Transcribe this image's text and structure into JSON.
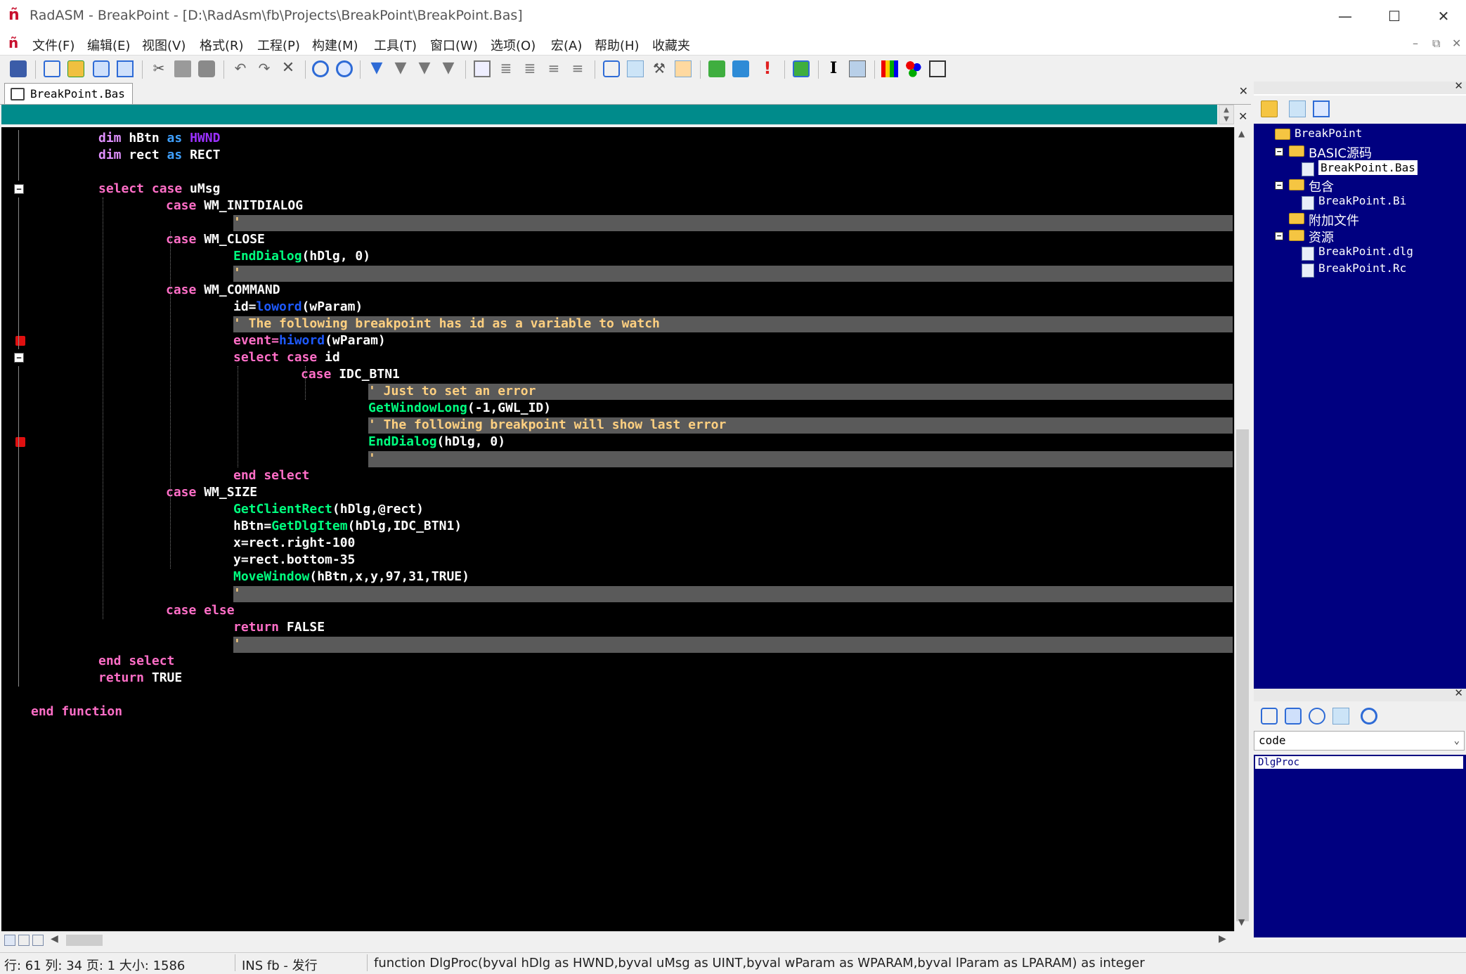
{
  "window": {
    "title": "RadASM - BreakPoint - [D:\\RadAsm\\fb\\Projects\\BreakPoint\\BreakPoint.Bas]",
    "minimize": "—",
    "maximize": "☐",
    "close": "✕"
  },
  "menu": {
    "items": [
      "文件(F)",
      "编辑(E)",
      "视图(V)",
      "格式(R)",
      "工程(P)",
      "构建(M)",
      "工具(T)",
      "窗口(W)",
      "选项(O)",
      "宏(A)",
      "帮助(H)",
      "收藏夹"
    ]
  },
  "toolbar": {
    "icons": [
      "print-icon",
      "new-file-icon",
      "open-file-icon",
      "save-icon",
      "save-all-icon",
      "cut-icon",
      "copy-icon",
      "paste-icon",
      "undo-icon",
      "redo-icon",
      "delete-icon",
      "find-icon",
      "replace-icon",
      "bookmark-toggle-icon",
      "bookmark-next-icon",
      "bookmark-prev-icon",
      "bookmark-clear-icon",
      "block-comment-icon",
      "indent-icon",
      "outdent-icon",
      "comment-icon",
      "uncomment-icon",
      "view-output-icon",
      "view-project-icon",
      "tools-icon",
      "view-properties-icon",
      "compile-icon",
      "build-icon",
      "run-debug-icon",
      "go-icon",
      "text-cursor-icon",
      "dialog-icon",
      "color-bars-icon",
      "palette-icon",
      "zoom-window-icon"
    ]
  },
  "editor": {
    "tab_label": "BreakPoint.Bas",
    "code_lines": [
      [
        {
          "cls": "kw",
          "t": "dim "
        },
        {
          "cls": "id",
          "t": "hBtn "
        },
        {
          "cls": "t",
          "t": "as "
        },
        {
          "cls": "hw",
          "t": "HWND"
        }
      ],
      [
        {
          "cls": "kw",
          "t": "dim "
        },
        {
          "cls": "id",
          "t": "rect "
        },
        {
          "cls": "t",
          "t": "as "
        },
        {
          "cls": "c",
          "t": "RECT"
        }
      ],
      [],
      [
        {
          "cls": "k",
          "t": "select case "
        },
        {
          "cls": "id",
          "t": "uMsg"
        }
      ],
      [
        {
          "cls": "k",
          "t": "case "
        },
        {
          "cls": "id",
          "t": "WM_INITDIALOG"
        }
      ],
      [
        {
          "cls": "cm",
          "t": "'"
        }
      ],
      [
        {
          "cls": "k",
          "t": "case "
        },
        {
          "cls": "id",
          "t": "WM_CLOSE"
        }
      ],
      [
        {
          "cls": "f",
          "t": "EndDialog"
        },
        {
          "cls": "id",
          "t": "(hDlg, 0)"
        }
      ],
      [
        {
          "cls": "cm",
          "t": "'"
        }
      ],
      [
        {
          "cls": "k",
          "t": "case "
        },
        {
          "cls": "id",
          "t": "WM_COMMAND"
        }
      ],
      [
        {
          "cls": "id",
          "t": "id="
        },
        {
          "cls": "api",
          "t": "loword"
        },
        {
          "cls": "id",
          "t": "(wParam)"
        }
      ],
      [
        {
          "cls": "cm",
          "t": "' The following breakpoint has id as a variable to watch"
        }
      ],
      [
        {
          "cls": "k",
          "t": "event="
        },
        {
          "cls": "api",
          "t": "hiword"
        },
        {
          "cls": "id",
          "t": "(wParam)"
        }
      ],
      [
        {
          "cls": "k",
          "t": "select case "
        },
        {
          "cls": "id",
          "t": "id"
        }
      ],
      [
        {
          "cls": "k",
          "t": "case "
        },
        {
          "cls": "id",
          "t": "IDC_BTN1"
        }
      ],
      [
        {
          "cls": "cm",
          "t": "' Just to set an error"
        }
      ],
      [
        {
          "cls": "f",
          "t": "GetWindowLong"
        },
        {
          "cls": "id",
          "t": "(-1,GWL_ID)"
        }
      ],
      [
        {
          "cls": "cm",
          "t": "' The following breakpoint will show last error"
        }
      ],
      [
        {
          "cls": "f",
          "t": "EndDialog"
        },
        {
          "cls": "id",
          "t": "(hDlg, 0)"
        }
      ],
      [
        {
          "cls": "cm",
          "t": "'"
        }
      ],
      [
        {
          "cls": "k",
          "t": "end select"
        }
      ],
      [
        {
          "cls": "k",
          "t": "case "
        },
        {
          "cls": "id",
          "t": "WM_SIZE"
        }
      ],
      [
        {
          "cls": "f",
          "t": "GetClientRect"
        },
        {
          "cls": "id",
          "t": "(hDlg,@rect)"
        }
      ],
      [
        {
          "cls": "id",
          "t": "hBtn="
        },
        {
          "cls": "f",
          "t": "GetDlgItem"
        },
        {
          "cls": "id",
          "t": "(hDlg,IDC_BTN1)"
        }
      ],
      [
        {
          "cls": "id",
          "t": "x=rect.right-100"
        }
      ],
      [
        {
          "cls": "id",
          "t": "y=rect.bottom-35"
        }
      ],
      [
        {
          "cls": "f",
          "t": "MoveWindow"
        },
        {
          "cls": "id",
          "t": "(hBtn,x,y,97,31,TRUE)"
        }
      ],
      [
        {
          "cls": "cm",
          "t": "'"
        }
      ],
      [
        {
          "cls": "k",
          "t": "case else"
        }
      ],
      [
        {
          "cls": "k",
          "t": "return "
        },
        {
          "cls": "id",
          "t": "FALSE"
        }
      ],
      [
        {
          "cls": "cm",
          "t": "'"
        }
      ],
      [
        {
          "cls": "k",
          "t": "end select"
        }
      ],
      [
        {
          "cls": "k",
          "t": "return "
        },
        {
          "cls": "id",
          "t": "TRUE"
        }
      ],
      [],
      [
        {
          "cls": "k",
          "t": "end function"
        }
      ]
    ],
    "indent_levels": [
      1,
      1,
      0,
      1,
      2,
      3,
      2,
      3,
      3,
      2,
      3,
      3,
      3,
      3,
      4,
      5,
      5,
      5,
      5,
      5,
      3,
      2,
      3,
      3,
      3,
      3,
      3,
      3,
      2,
      3,
      3,
      1,
      1,
      0,
      0
    ],
    "highlighted_lines": [
      5,
      8,
      11,
      15,
      17,
      19,
      27,
      30
    ],
    "breakpoint_lines": [
      12,
      18
    ],
    "fold_lines": [
      3,
      13
    ]
  },
  "project": {
    "tree": [
      {
        "label": "BreakPoint",
        "kind": "root"
      },
      {
        "label": "BASIC源码",
        "kind": "folder"
      },
      {
        "label": "BreakPoint.Bas",
        "kind": "file",
        "selected": true
      },
      {
        "label": "包含",
        "kind": "folder"
      },
      {
        "label": "BreakPoint.Bi",
        "kind": "file"
      },
      {
        "label": "附加文件",
        "kind": "folder"
      },
      {
        "label": "资源",
        "kind": "folder"
      },
      {
        "label": "BreakPoint.dlg",
        "kind": "file"
      },
      {
        "label": "BreakPoint.Rc",
        "kind": "file"
      }
    ]
  },
  "properties": {
    "combo_value": "code",
    "list_items": [
      "DlgProc"
    ]
  },
  "status": {
    "position": "行: 61   列:  34 页: 1 大小: 1586",
    "mode": "INS fb - 发行",
    "signature": "function DlgProc(byval hDlg as HWND,byval uMsg as UINT,byval wParam as WPARAM,byval lParam as LPARAM) as integer"
  }
}
